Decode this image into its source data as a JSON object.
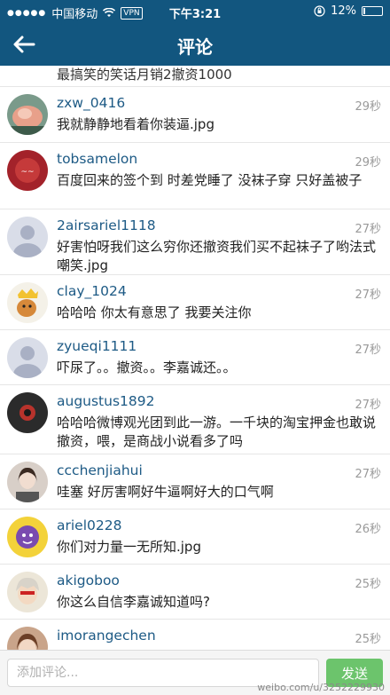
{
  "status_bar": {
    "carrier": "中国移动",
    "vpn": "VPN",
    "time": "下午3:21",
    "battery": "12%",
    "battery_level": 0.12,
    "signal_icon": "signal-dots-icon",
    "wifi_icon": "wifi-icon",
    "lock_icon": "orientation-lock-icon"
  },
  "nav": {
    "title": "评论",
    "back_icon": "arrow-left-icon"
  },
  "top_snippet": "最搞笑的笑话月销2撤资1000",
  "comments": [
    {
      "user": "zxw_0416",
      "time": "29秒",
      "text": "我就静静地看着你装逼.jpg"
    },
    {
      "user": "tobsamelon",
      "time": "29秒",
      "text": "百度回来的签个到 时差党睡了 没袜子穿 只好盖被子"
    },
    {
      "user": "2airsariel1118",
      "time": "27秒",
      "text": "好害怕呀我们这么穷你还撤资我们买不起袜子了哟法式嘲笑.jpg"
    },
    {
      "user": "clay_1024",
      "time": "27秒",
      "text": "哈哈哈  你太有意思了  我要关注你"
    },
    {
      "user": "zyueqi1111",
      "time": "27秒",
      "text": "吓尿了。。撤资。。李嘉诚还。。"
    },
    {
      "user": "augustus1892",
      "time": "27秒",
      "text": "哈哈哈微博观光团到此一游。一千块的淘宝押金也敢说撤资，喂，是商战小说看多了吗"
    },
    {
      "user": "ccchenjiahui",
      "time": "27秒",
      "text": "哇塞 好厉害啊好牛逼啊好大的口气啊"
    },
    {
      "user": "ariel0228",
      "time": "26秒",
      "text": "你们对力量一无所知.jpg"
    },
    {
      "user": "akigoboo",
      "time": "25秒",
      "text": "你这么自信李嘉诚知道吗?"
    },
    {
      "user": "imorangechen",
      "time": "25秒",
      "text": ""
    }
  ],
  "input": {
    "placeholder": "添加评论...",
    "send_label": "发送"
  },
  "watermark": "weibo.com/u/3252229930",
  "colors": {
    "header": "#12567f",
    "username": "#1d5a85",
    "send_button": "#6cc46c"
  }
}
